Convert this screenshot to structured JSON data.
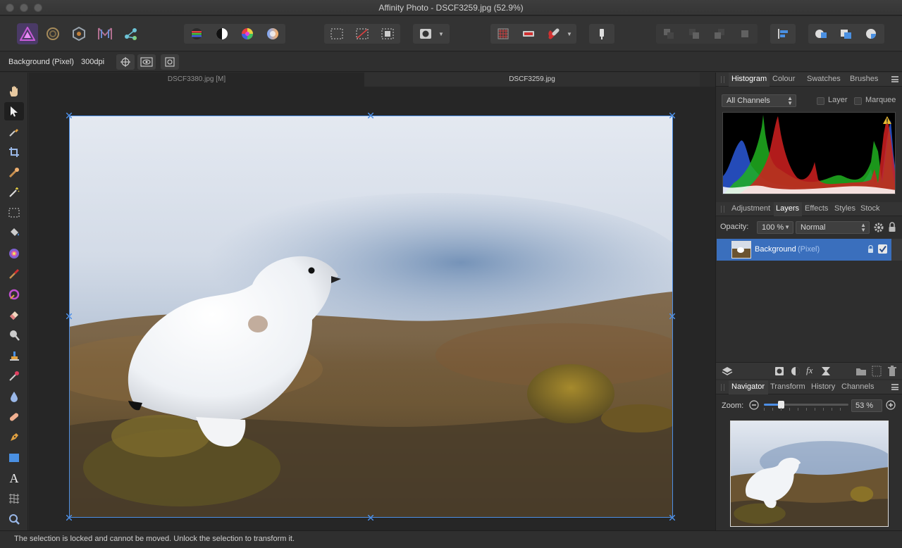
{
  "window": {
    "title": "Affinity Photo - DSCF3259.jpg (52.9%)"
  },
  "context": {
    "layer_label": "Background (Pixel)",
    "dpi": "300dpi"
  },
  "documents": [
    {
      "label": "DSCF3380.jpg [M]"
    },
    {
      "label": "DSCF3259.jpg"
    }
  ],
  "histogram_panel": {
    "tabs": [
      "Histogram",
      "Colour",
      "Swatches",
      "Brushes"
    ],
    "channel": "All Channels",
    "layer_option": "Layer",
    "marquee_option": "Marquee"
  },
  "layers_panel": {
    "tabs": [
      "Adjustment",
      "Layers",
      "Effects",
      "Styles",
      "Stock"
    ],
    "opacity_label": "Opacity:",
    "opacity_value": "100 %",
    "blend_mode": "Normal",
    "layer_name": "Background",
    "layer_type": "(Pixel)"
  },
  "navigator_panel": {
    "tabs": [
      "Navigator",
      "Transform",
      "History",
      "Channels"
    ],
    "zoom_label": "Zoom:",
    "zoom_value": "53 %",
    "zoom_fraction": 0.2
  },
  "status": {
    "message": "The selection is locked and cannot be moved. Unlock the selection to transform it."
  },
  "colors": {
    "accent": "#3a6fbd",
    "selection": "#4d8fe6"
  }
}
